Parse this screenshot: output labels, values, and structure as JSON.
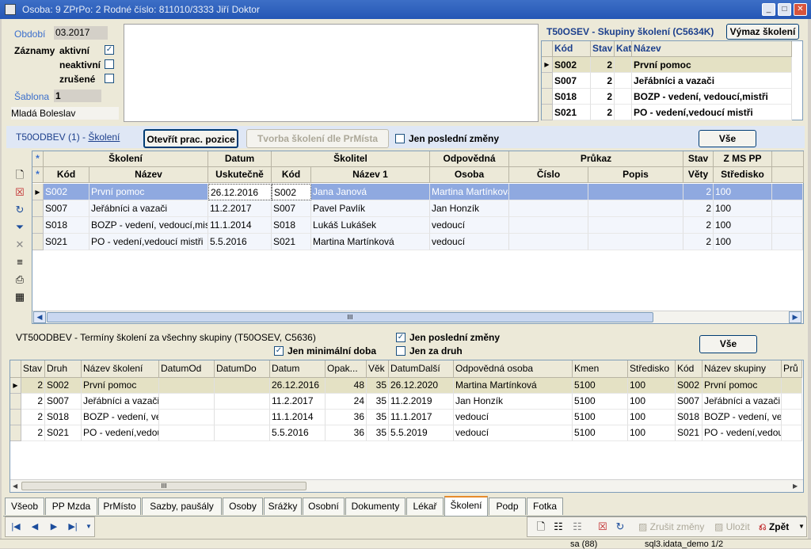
{
  "title": {
    "text": "Osoba: 9   ZPrPo: 2     Rodné číslo: 811010/3333  Jiří Doktor"
  },
  "filter": {
    "obdobi_label": "Období",
    "obdobi_value": "03.2017",
    "zaznamy_label": "Záznamy",
    "aktivni_label": "aktivní",
    "aktivni_checked": "✓",
    "neaktivni_label": "neaktivní",
    "neaktivni_checked": "",
    "zrusene_label": "zrušené",
    "zrusene_checked": "",
    "sablona_label": "Šablona",
    "sablona_value": "1",
    "location": "Mladá Boleslav"
  },
  "osev": {
    "title": "T50OSEV - Skupiny školení (C5634K)",
    "vymaz_button": "Výmaz školení",
    "headers": [
      "Kód",
      "Stav",
      "Kat",
      "Název"
    ],
    "rows": [
      {
        "kod": "S002",
        "stav": "2",
        "kat": "",
        "nazev": "První pomoc"
      },
      {
        "kod": "S007",
        "stav": "2",
        "kat": "",
        "nazev": "Jeřábníci a vazači"
      },
      {
        "kod": "S018",
        "stav": "2",
        "kat": "",
        "nazev": "BOZP - vedení, vedoucí,mistři"
      },
      {
        "kod": "S021",
        "stav": "2",
        "kat": "",
        "nazev": "PO - vedení,vedoucí mistři"
      }
    ]
  },
  "odbev": {
    "title": "T50ODBEV (1) - ",
    "title_link": "Školení",
    "open_button": "Otevřít prac. pozice",
    "tvorba_button": "Tvorba školení dle PrMísta",
    "jen_posledni_label": "Jen poslední změny",
    "jen_posledni_checked": "",
    "vse_button": "Vše",
    "group_headers": [
      "Školení",
      "Datum",
      "Školitel",
      "Odpovědná",
      "Průkaz",
      "Stav",
      "Z MS PP"
    ],
    "headers": [
      "Kód",
      "Název",
      "Uskutečně",
      "Kód",
      "Název 1",
      "Osoba",
      "Číslo",
      "Popis",
      "Věty",
      "Středisko"
    ],
    "rows": [
      {
        "kod": "S002",
        "nazev": "První pomoc",
        "datum": "26.12.2016",
        "skod": "S002",
        "snazev": "Jana Janová",
        "osoba": "Martina Martínková",
        "cislo": "",
        "popis": "",
        "vety": "2",
        "stred": "100"
      },
      {
        "kod": "S007",
        "nazev": "Jeřábníci a vazači",
        "datum": "11.2.2017",
        "skod": "S007",
        "snazev": "Pavel Pavlík",
        "osoba": "Jan Honzík",
        "cislo": "",
        "popis": "",
        "vety": "2",
        "stred": "100"
      },
      {
        "kod": "S018",
        "nazev": "BOZP - vedení, vedoucí,mistři",
        "datum": "11.1.2014",
        "skod": "S018",
        "snazev": "Lukáš Lukášek",
        "osoba": "vedoucí",
        "cislo": "",
        "popis": "",
        "vety": "2",
        "stred": "100"
      },
      {
        "kod": "S021",
        "nazev": "PO - vedení,vedoucí mistři",
        "datum": "5.5.2016",
        "skod": "S021",
        "snazev": "Martina Martínková",
        "osoba": "vedoucí",
        "cislo": "",
        "popis": "",
        "vety": "2",
        "stred": "100"
      }
    ],
    "hscroll_mark": "III"
  },
  "terminy": {
    "title": "VT50ODBEV - Termíny školení za všechny skupiny (T50OSEV, C5636)",
    "jen_min_label": "Jen minimální doba",
    "jen_min_checked": "✓",
    "jen_posledni_label": "Jen poslední změny",
    "jen_posledni_checked": "✓",
    "jen_druh_label": "Jen za druh",
    "jen_druh_checked": "",
    "vse_button": "Vše",
    "headers": [
      "Stav",
      "Druh",
      "Název školení",
      "DatumOd",
      "DatumDo",
      "Datum",
      "Opak...",
      "Věk",
      "DatumDalší",
      "Odpovědná osoba",
      "Kmen",
      "Středisko",
      "Kód",
      "Název skupiny",
      "Prů"
    ],
    "rows": [
      {
        "stav": "2",
        "druh": "S002",
        "nazev": "První pomoc",
        "od": "",
        "do": "",
        "datum": "26.12.2016",
        "opak": "48",
        "vek": "35",
        "dalsi": "26.12.2020",
        "osoba": "Martina Martínková",
        "kmen": "5100",
        "stred": "100",
        "kod": "S002",
        "skup": "První pomoc"
      },
      {
        "stav": "2",
        "druh": "S007",
        "nazev": "Jeřábníci a vazači",
        "od": "",
        "do": "",
        "datum": "11.2.2017",
        "opak": "24",
        "vek": "35",
        "dalsi": "11.2.2019",
        "osoba": "Jan Honzík",
        "kmen": "5100",
        "stred": "100",
        "kod": "S007",
        "skup": "Jeřábníci a vazači"
      },
      {
        "stav": "2",
        "druh": "S018",
        "nazev": "BOZP - vedení, vedoucí,mistři",
        "od": "",
        "do": "",
        "datum": "11.1.2014",
        "opak": "36",
        "vek": "35",
        "dalsi": "11.1.2017",
        "osoba": "vedoucí",
        "kmen": "5100",
        "stred": "100",
        "kod": "S018",
        "skup": "BOZP - vedení, vedoucí,mistři"
      },
      {
        "stav": "2",
        "druh": "S021",
        "nazev": "PO - vedení,vedoucí mistři",
        "od": "",
        "do": "",
        "datum": "5.5.2016",
        "opak": "36",
        "vek": "35",
        "dalsi": "5.5.2019",
        "osoba": "vedoucí",
        "kmen": "5100",
        "stred": "100",
        "kod": "S021",
        "skup": "PO - vedení,vedoucí mistři"
      }
    ],
    "hscroll_mark": "III"
  },
  "tabs": [
    "Všeob",
    "PP Mzda",
    "PrMísto",
    "Sazby, paušály",
    "Osoby",
    "Srážky",
    "Osobní",
    "Dokumenty",
    "Lékař",
    "Školení",
    "Podp",
    "Fotka"
  ],
  "active_tab": "Školení",
  "toolbar": {
    "zrusit": "Zrušit změny",
    "ulozit": "Uložit",
    "zpet": "Zpět"
  },
  "status": {
    "user": "sa (88)",
    "db": "sql3.idata_demo 1/2"
  },
  "window_buttons": {
    "minimize": "_",
    "maximize": "□",
    "close": "✕"
  }
}
